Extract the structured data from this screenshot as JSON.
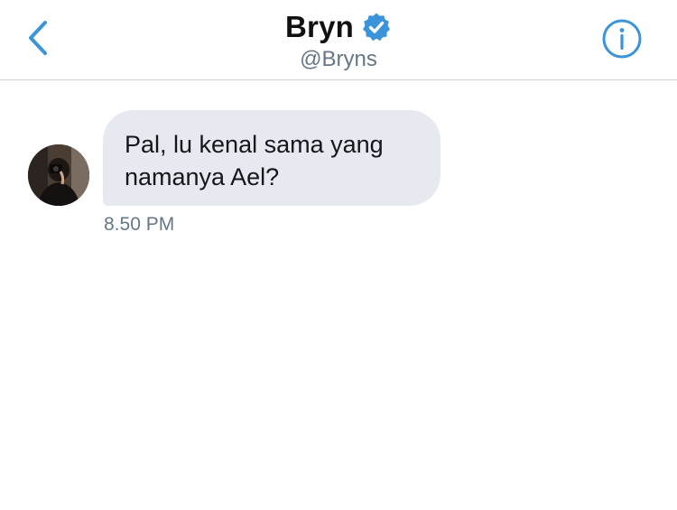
{
  "header": {
    "back_icon": "chevron-left-icon",
    "name": "Bryn",
    "verified_icon": "verified-badge-icon",
    "handle": "@Bryns",
    "info_icon": "info-icon"
  },
  "conversation": {
    "messages": [
      {
        "text_line1": "Pal, lu kenal sama yang",
        "text_line2": "namanya Ael?",
        "time": "8.50 PM"
      }
    ]
  },
  "colors": {
    "accent": "#3b94d9",
    "bubble_bg": "#e6e9f0",
    "muted_text": "#657786",
    "divider": "#cfd4d9"
  }
}
